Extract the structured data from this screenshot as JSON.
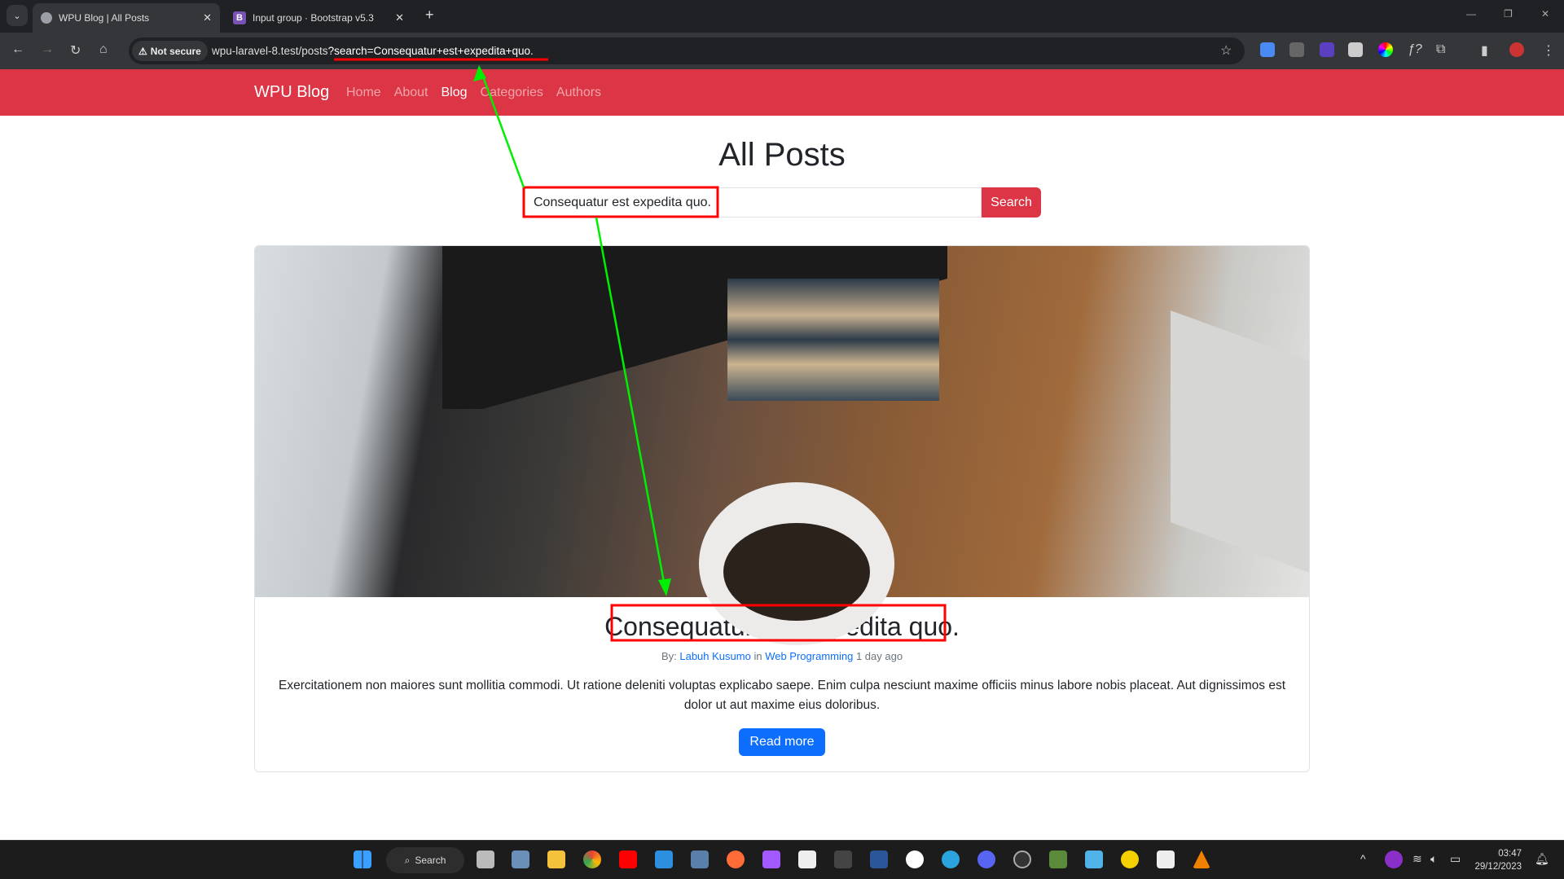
{
  "browser": {
    "tabs": [
      {
        "title": "WPU Blog | All Posts",
        "active": true
      },
      {
        "title": "Input group · Bootstrap v5.3",
        "active": false
      }
    ],
    "security_label": "Not secure",
    "url_base": "wpu-laravel-8.test/posts",
    "url_query": "?search=Consequatur+est+expedita+quo."
  },
  "navbar": {
    "brand": "WPU Blog",
    "links": [
      {
        "label": "Home"
      },
      {
        "label": "About"
      },
      {
        "label": "Blog",
        "active": true
      },
      {
        "label": "Categories"
      },
      {
        "label": "Authors"
      }
    ],
    "color": "#dc3545"
  },
  "page": {
    "title": "All Posts"
  },
  "search": {
    "value": "Consequatur est expedita quo.",
    "button": "Search"
  },
  "post": {
    "title": "Consequatur est expedita quo.",
    "by_label": "By:",
    "author": "Labuh Kusumo",
    "in_label": "in",
    "category": "Web Programming",
    "time": "1 day ago",
    "excerpt": "Exercitationem non maiores sunt mollitia commodi. Ut ratione deleniti voluptas explicabo saepe. Enim culpa nesciunt maxime officiis minus labore nobis placeat. Aut dignissimos est dolor ut aut maxime eius doloribus.",
    "read_more": "Read more"
  },
  "taskbar": {
    "search": "Search",
    "time": "03:47",
    "date": "29/12/2023"
  },
  "annotation_colors": {
    "box": "#ff0000",
    "arrow": "#00e000"
  }
}
